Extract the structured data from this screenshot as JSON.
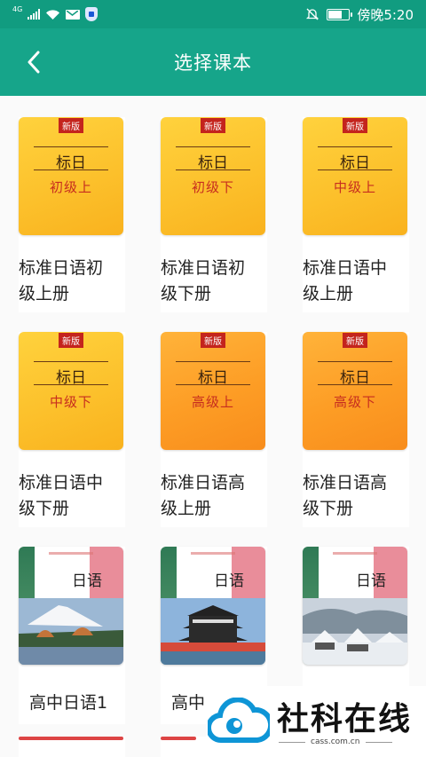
{
  "status_bar": {
    "network_label": "4G",
    "time": "傍晚5:20"
  },
  "header": {
    "title": "选择课本"
  },
  "books": [
    {
      "name": "标准日语初级上册",
      "line1": "标准日语初",
      "line2": "级上册",
      "cover_tag": "新版",
      "cover_title": "标日",
      "cover_sub": "初级上",
      "style": "yellow"
    },
    {
      "name": "标准日语初级下册",
      "line1": "标准日语初",
      "line2": "级下册",
      "cover_tag": "新版",
      "cover_title": "标日",
      "cover_sub": "初级下",
      "style": "yellow"
    },
    {
      "name": "标准日语中级上册",
      "line1": "标准日语中",
      "line2": "级上册",
      "cover_tag": "新版",
      "cover_title": "标日",
      "cover_sub": "中级上",
      "style": "yellow"
    },
    {
      "name": "标准日语中级下册",
      "line1": "标准日语中",
      "line2": "级下册",
      "cover_tag": "新版",
      "cover_title": "标日",
      "cover_sub": "中级下",
      "style": "yellow"
    },
    {
      "name": "标准日语高级上册",
      "line1": "标准日语高",
      "line2": "级上册",
      "cover_tag": "新版",
      "cover_title": "标日",
      "cover_sub": "高级上",
      "style": "orange"
    },
    {
      "name": "标准日语高级下册",
      "line1": "标准日语高",
      "line2": "级下册",
      "cover_tag": "新版",
      "cover_title": "标日",
      "cover_sub": "高级下",
      "style": "orange"
    },
    {
      "name": "高中日语1",
      "line1": "高中日语1",
      "line2": "",
      "cover_title": "日语",
      "style": "photo-fuji"
    },
    {
      "name": "高中",
      "line1": "高中",
      "line2": "",
      "cover_title": "日语",
      "style": "photo-castle"
    },
    {
      "name": "",
      "line1": "",
      "line2": "",
      "cover_title": "日语",
      "style": "photo-snow"
    }
  ],
  "watermark": {
    "text": "社科在线",
    "url": "cass.com.cn"
  },
  "colors": {
    "header_bg": "#16a58a",
    "status_bg": "#119c80",
    "cover_red_tag": "#c4241d"
  },
  "icons": [
    "signal-icon",
    "wifi-icon",
    "mail-icon",
    "shield-icon",
    "mute-bell-icon",
    "battery-icon",
    "back-arrow-icon"
  ]
}
